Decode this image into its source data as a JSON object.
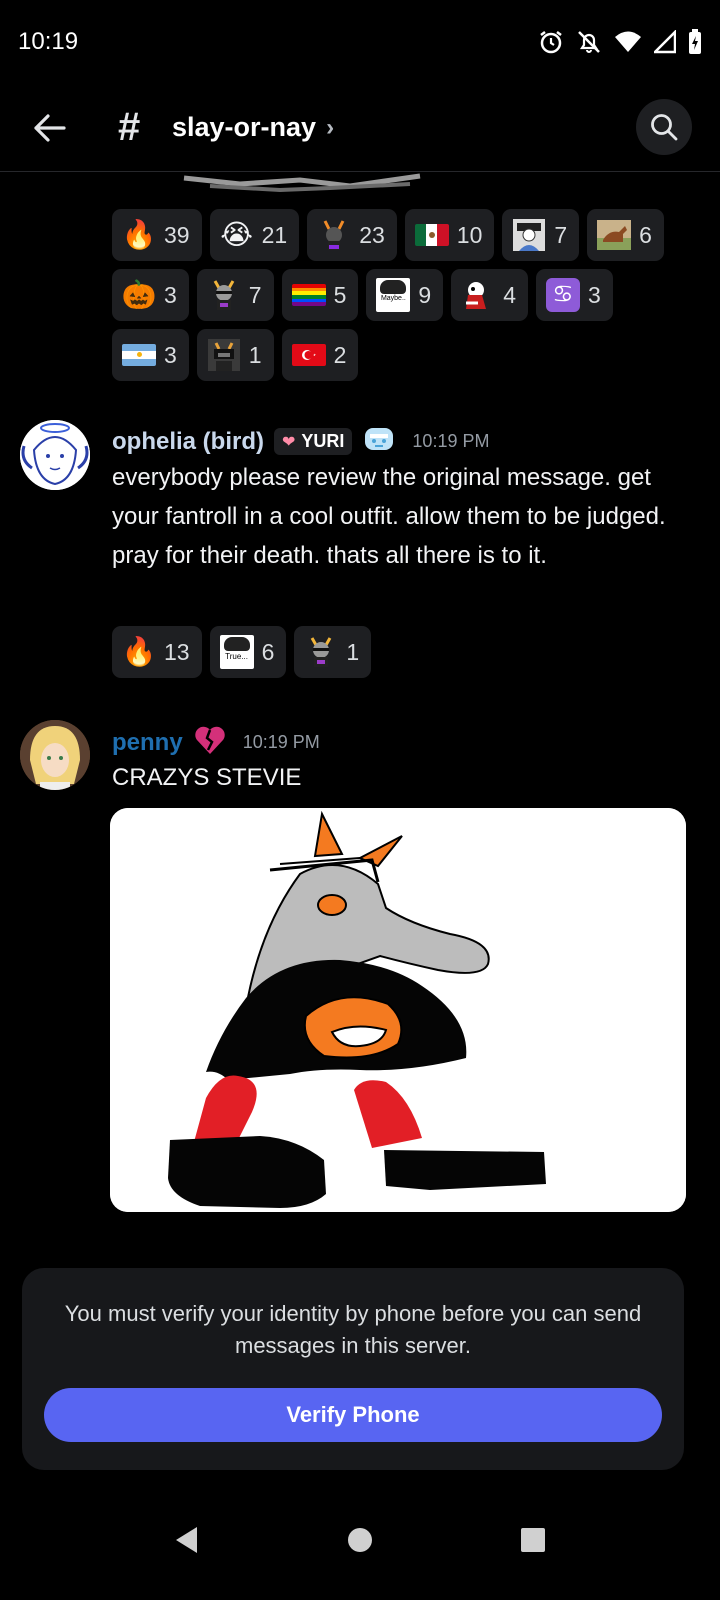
{
  "status_bar": {
    "time": "10:19",
    "icons": [
      "alarm-icon",
      "bell-off-icon",
      "wifi-icon",
      "signal-icon",
      "battery-icon"
    ]
  },
  "header": {
    "channel_name": "slay-or-nay",
    "hash_symbol": "#",
    "chevron": "›"
  },
  "reactions_top": [
    {
      "emoji": "fire",
      "glyph": "🔥",
      "count": "39"
    },
    {
      "emoji": "loudly-crying",
      "glyph": "😭",
      "count": "21"
    },
    {
      "emoji": "troll-character",
      "glyph": "",
      "count": "23"
    },
    {
      "emoji": "flag-mexico",
      "glyph": "",
      "count": "10"
    },
    {
      "emoji": "character-portrait",
      "glyph": "",
      "count": "7"
    },
    {
      "emoji": "horse",
      "glyph": "",
      "count": "6"
    },
    {
      "emoji": "jack-o-lantern",
      "glyph": "🎃",
      "count": "3"
    },
    {
      "emoji": "troll-character-2",
      "glyph": "",
      "count": "7"
    },
    {
      "emoji": "rainbow-flag",
      "glyph": "",
      "count": "5"
    },
    {
      "emoji": "maybe-sticker",
      "glyph": "",
      "label": "Maybe..",
      "count": "9"
    },
    {
      "emoji": "character-3",
      "glyph": "",
      "count": "4"
    },
    {
      "emoji": "cancer-zodiac",
      "glyph": "♋",
      "count": "3"
    },
    {
      "emoji": "flag-argentina",
      "glyph": "",
      "count": "3"
    },
    {
      "emoji": "character-4",
      "glyph": "",
      "count": "1"
    },
    {
      "emoji": "flag-turkey",
      "glyph": "",
      "count": "2"
    }
  ],
  "messages": [
    {
      "author": "ophelia (bird)",
      "author_color": "#c9d8ec",
      "tag": "YURI",
      "timestamp": "10:19 PM",
      "text": "everybody please review the original message. get your fantroll in a cool outfit. allow them to be judged. pray for their death. thats all there is to it.",
      "reactions": [
        {
          "emoji": "fire",
          "glyph": "🔥",
          "count": "13"
        },
        {
          "emoji": "true-sticker",
          "glyph": "",
          "label": "True...",
          "count": "6"
        },
        {
          "emoji": "troll-character-2",
          "glyph": "",
          "count": "1"
        }
      ]
    },
    {
      "author": "penny",
      "author_color": "#1f6fb0",
      "badge": "broken-heart-icon",
      "timestamp": "10:19 PM",
      "text": "CRAZYS STEVIE"
    }
  ],
  "verify": {
    "message": "You must verify your identity by phone before you can send messages in this server.",
    "button": "Verify Phone"
  },
  "colors": {
    "background": "#000000",
    "reaction_bg": "#1e1f22",
    "accent": "#5865f2"
  }
}
